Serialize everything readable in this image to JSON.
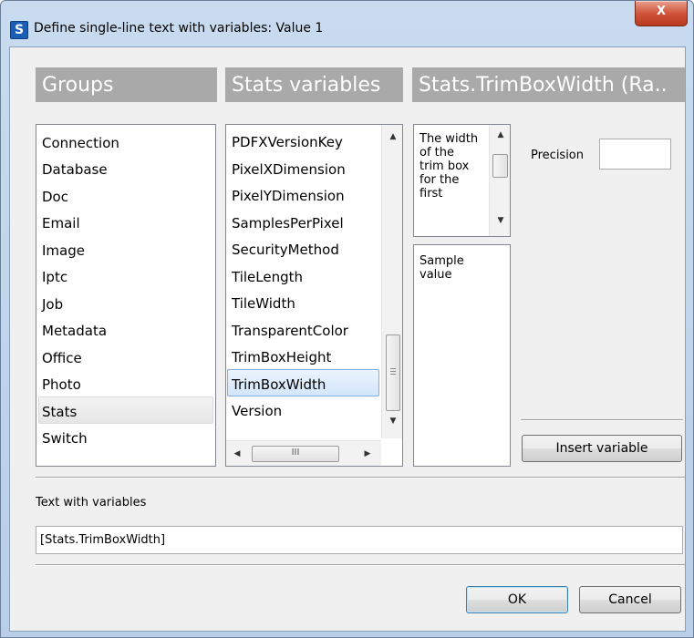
{
  "window": {
    "title": "Define single-line text with variables: Value 1",
    "app_icon_letter": "S",
    "close_label": "X"
  },
  "groups": {
    "header": "Groups",
    "items": [
      "Connection",
      "Database",
      "Doc",
      "Email",
      "Image",
      "Iptc",
      "Job",
      "Metadata",
      "Office",
      "Photo",
      "Stats",
      "Switch"
    ],
    "selected": "Stats"
  },
  "variables": {
    "header": "Stats variables",
    "items": [
      "PDFXVersionKey",
      "PixelXDimension",
      "PixelYDimension",
      "SamplesPerPixel",
      "SecurityMethod",
      "TileLength",
      "TileWidth",
      "TransparentColor",
      "TrimBoxHeight",
      "TrimBoxWidth",
      "Version"
    ],
    "selected": "TrimBoxWidth",
    "hscroll_grip": "III"
  },
  "detail": {
    "header": "Stats.TrimBoxWidth (Ra..",
    "description": "The width of the trim box for the first",
    "sample": "Sample value",
    "precision_label": "Precision",
    "precision_value": "",
    "insert_button": "Insert variable"
  },
  "text_with_variables": {
    "label": "Text with variables",
    "value": "[Stats.TrimBoxWidth]"
  },
  "buttons": {
    "ok": "OK",
    "cancel": "Cancel"
  },
  "colors": {
    "panel_header_bg": "#a9a9a9",
    "titlebar_bg": "#c4d8ee",
    "close_button": "#c8472c",
    "selection_border": "#84acdd"
  }
}
